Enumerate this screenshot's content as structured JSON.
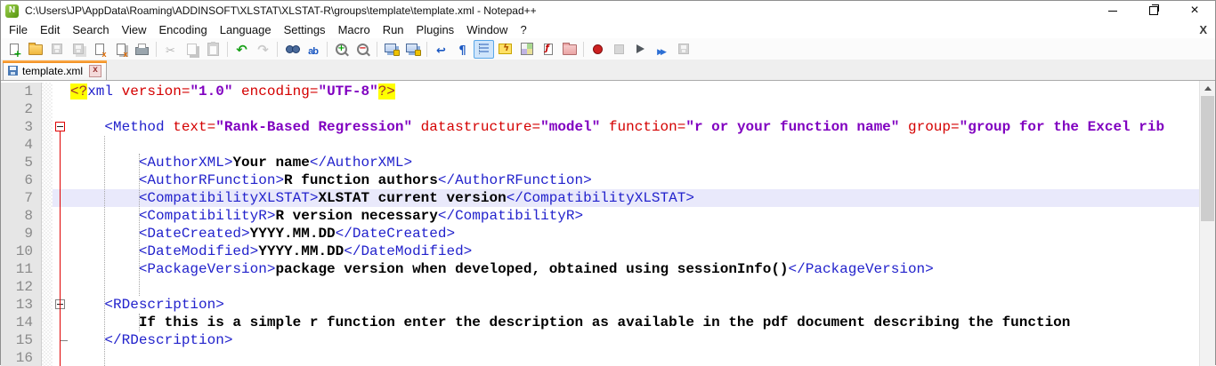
{
  "window": {
    "title": "C:\\Users\\JP\\AppData\\Roaming\\ADDINSOFT\\XLSTAT\\XLSTAT-R\\groups\\template\\template.xml - Notepad++"
  },
  "menu": {
    "items": [
      "File",
      "Edit",
      "Search",
      "View",
      "Encoding",
      "Language",
      "Settings",
      "Macro",
      "Run",
      "Plugins",
      "Window",
      "?"
    ],
    "close_doc_label": "X"
  },
  "toolbar": {
    "icons": [
      {
        "name": "new-file"
      },
      {
        "name": "open-file"
      },
      {
        "name": "save",
        "disabled": true
      },
      {
        "name": "save-all",
        "disabled": true
      },
      {
        "name": "close-file"
      },
      {
        "name": "close-all"
      },
      {
        "name": "print"
      },
      {
        "sep": true
      },
      {
        "name": "cut",
        "disabled": true
      },
      {
        "name": "copy",
        "disabled": true
      },
      {
        "name": "paste",
        "disabled": true
      },
      {
        "sep": true
      },
      {
        "name": "undo"
      },
      {
        "name": "redo",
        "disabled": true
      },
      {
        "sep": true
      },
      {
        "name": "find"
      },
      {
        "name": "replace"
      },
      {
        "sep": true
      },
      {
        "name": "zoom-in"
      },
      {
        "name": "zoom-out"
      },
      {
        "sep": true
      },
      {
        "name": "sync-vertical"
      },
      {
        "name": "sync-horizontal"
      },
      {
        "sep": true
      },
      {
        "name": "word-wrap"
      },
      {
        "name": "show-all-characters"
      },
      {
        "name": "show-indent-guide",
        "active": true
      },
      {
        "name": "user-defined-language"
      },
      {
        "name": "document-map"
      },
      {
        "name": "function-list"
      },
      {
        "name": "folder-as-workspace"
      },
      {
        "sep": true
      },
      {
        "name": "macro-record"
      },
      {
        "name": "macro-stop",
        "disabled": true
      },
      {
        "name": "macro-play"
      },
      {
        "name": "macro-run-multiple"
      },
      {
        "name": "macro-save",
        "disabled": true
      }
    ]
  },
  "tabbar": {
    "tabs": [
      {
        "label": "template.xml",
        "active": true,
        "saved": true,
        "close_label": "x"
      }
    ]
  },
  "editor": {
    "lines": [
      {
        "n": 1,
        "segs": [
          {
            "s": "dhl",
            "t": "<?"
          },
          {
            "s": "tag",
            "t": "xml"
          },
          {
            "s": "attr",
            "t": " version="
          },
          {
            "s": "val",
            "t": "\"1.0\""
          },
          {
            "s": "attr",
            "t": " encoding="
          },
          {
            "s": "val",
            "t": "\"UTF-8\""
          },
          {
            "s": "dhl",
            "t": "?>"
          }
        ]
      },
      {
        "n": 2,
        "segs": []
      },
      {
        "n": 3,
        "fold": "red",
        "segs": [
          {
            "s": "tag",
            "t": "    <Method"
          },
          {
            "s": "attr",
            "t": " text="
          },
          {
            "s": "val",
            "t": "\"Rank-Based Regression\""
          },
          {
            "s": "attr",
            "t": " datastructure="
          },
          {
            "s": "val",
            "t": "\"model\""
          },
          {
            "s": "attr",
            "t": " function="
          },
          {
            "s": "val",
            "t": "\"r or your function name\""
          },
          {
            "s": "attr",
            "t": " group="
          },
          {
            "s": "val",
            "t": "\"group for the Excel rib"
          }
        ]
      },
      {
        "n": 4,
        "segs": []
      },
      {
        "n": 5,
        "segs": [
          {
            "s": "tag",
            "t": "        <AuthorXML>"
          },
          {
            "s": "txt",
            "t": "Your name"
          },
          {
            "s": "tag",
            "t": "</AuthorXML>"
          }
        ]
      },
      {
        "n": 6,
        "segs": [
          {
            "s": "tag",
            "t": "        <AuthorRFunction>"
          },
          {
            "s": "txt",
            "t": "R function authors"
          },
          {
            "s": "tag",
            "t": "</AuthorRFunction>"
          }
        ]
      },
      {
        "n": 7,
        "hl": true,
        "segs": [
          {
            "s": "tag",
            "t": "        <CompatibilityXLSTAT>"
          },
          {
            "s": "txt",
            "t": "XLSTAT current version"
          },
          {
            "s": "tag",
            "t": "</CompatibilityXLSTAT>"
          }
        ]
      },
      {
        "n": 8,
        "segs": [
          {
            "s": "tag",
            "t": "        <CompatibilityR>"
          },
          {
            "s": "txt",
            "t": "R version necessary"
          },
          {
            "s": "tag",
            "t": "</CompatibilityR>"
          }
        ]
      },
      {
        "n": 9,
        "segs": [
          {
            "s": "tag",
            "t": "        <DateCreated>"
          },
          {
            "s": "txt",
            "t": "YYYY.MM.DD"
          },
          {
            "s": "tag",
            "t": "</DateCreated>"
          }
        ]
      },
      {
        "n": 10,
        "segs": [
          {
            "s": "tag",
            "t": "        <DateModified>"
          },
          {
            "s": "txt",
            "t": "YYYY.MM.DD"
          },
          {
            "s": "tag",
            "t": "</DateModified>"
          }
        ]
      },
      {
        "n": 11,
        "segs": [
          {
            "s": "tag",
            "t": "        <PackageVersion>"
          },
          {
            "s": "txt",
            "t": "package version when developed, obtained using sessionInfo()"
          },
          {
            "s": "tag",
            "t": "</PackageVersion>"
          }
        ]
      },
      {
        "n": 12,
        "segs": []
      },
      {
        "n": 13,
        "fold": "gray",
        "segs": [
          {
            "s": "tag",
            "t": "    <RDescription>"
          }
        ]
      },
      {
        "n": 14,
        "segs": [
          {
            "s": "txt",
            "t": "        If this is a simple r function enter the description as available in the pdf document describing the function"
          }
        ]
      },
      {
        "n": 15,
        "segs": [
          {
            "s": "tag",
            "t": "    </RDescription>"
          }
        ]
      },
      {
        "n": 16,
        "segs": []
      }
    ]
  },
  "theme": {
    "accent": "#f08c1c",
    "tag": "#2222cc",
    "attr": "#d40000",
    "val": "#8000c0",
    "txt": "#000000",
    "dhl": "#9c3030",
    "dhlbg": "#ffff00",
    "caretline": "#e9e9fb",
    "marginbg": "#e6e6e6",
    "lnum": "#8a8a8a",
    "foldred": "#e00000",
    "foldgray": "#808080"
  }
}
